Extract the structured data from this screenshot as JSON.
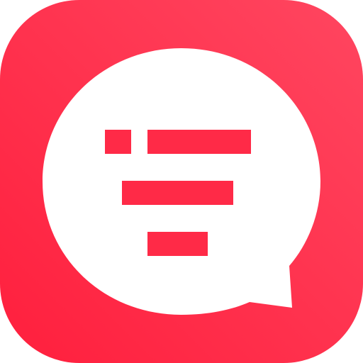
{
  "icon": {
    "name": "app-icon",
    "glyph": "chat-bubble-filter-icon",
    "colors": {
      "gradient_start": "#ff1f3d",
      "gradient_end": "#ff4660",
      "bubble": "#ffffff",
      "bars": "#ff2a47"
    }
  }
}
